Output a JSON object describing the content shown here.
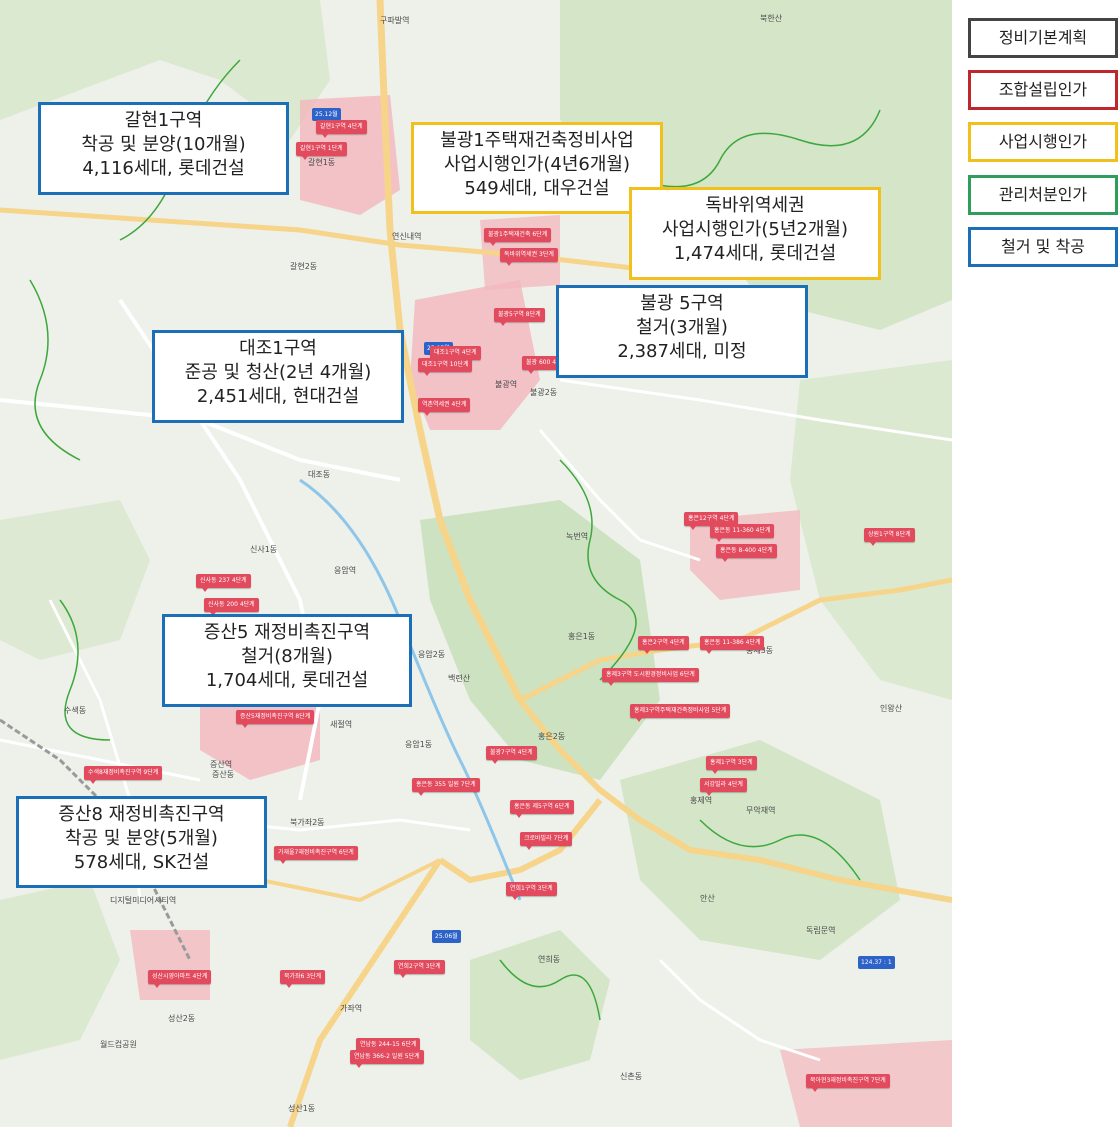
{
  "legend": [
    {
      "label": "정비기본계획",
      "color": "#444444"
    },
    {
      "label": "조합설립인가",
      "color": "#c0272d"
    },
    {
      "label": "사업시행인가",
      "color": "#f2c01c"
    },
    {
      "label": "관리처분인가",
      "color": "#2e9e5a"
    },
    {
      "label": "철거 및 착공",
      "color": "#1a6fb8"
    }
  ],
  "callouts": {
    "galhyeon1": {
      "lines": [
        "갈현1구역",
        "착공 및 분양(10개월)",
        "4,116세대, 롯데건설"
      ],
      "stage_color": "#1a6fb8"
    },
    "bulgwang1": {
      "lines": [
        "불광1주택재건축정비사업",
        "사업시행인가(4년6개월)",
        "549세대, 대우건설"
      ],
      "stage_color": "#f2c01c"
    },
    "dokbawi": {
      "lines": [
        "독바위역세권",
        "사업시행인가(5년2개월)",
        "1,474세대, 롯데건설"
      ],
      "stage_color": "#f2c01c"
    },
    "bulgwang5": {
      "lines": [
        "불광 5구역",
        "철거(3개월)",
        "2,387세대, 미정"
      ],
      "stage_color": "#1a6fb8"
    },
    "daejo1": {
      "lines": [
        "대조1구역",
        "준공 및 청산(2년 4개월)",
        "2,451세대, 현대건설"
      ],
      "stage_color": "#1a6fb8"
    },
    "jeungsan5": {
      "lines": [
        "증산5 재정비촉진구역",
        "철거(8개월)",
        "1,704세대, 롯데건설"
      ],
      "stage_color": "#1a6fb8"
    },
    "jeungsan8": {
      "lines": [
        "증산8 재정비촉진구역",
        "착공 및 분양(5개월)",
        "578세대, SK건설"
      ],
      "stage_color": "#1a6fb8"
    }
  },
  "map_labels": {
    "galhyeon1dong": "갈현1동",
    "galhyeon2dong": "갈현2동",
    "bulgwang2dong": "불광2동",
    "daejodong": "대조동",
    "sinsa1dong": "신사1동",
    "eungam2dong": "응암2동",
    "eungam1dong": "응암1동",
    "jeungsandong": "증산동",
    "susaekdong": "수색동",
    "hongeun1dong": "홍은1동",
    "hongeun2dong": "홍은2동",
    "yeonhuidong": "연희동",
    "sinchondong": "신촌동",
    "bukgajwa2dong": "북가좌2동",
    "seongsan2dong": "성산2동",
    "seongsan1dong": "성산1동",
    "hongje3dong": "홍제3동",
    "muakjae": "무악재역",
    "dokribmun": "독립문역",
    "bulgwang_stn": "불광역",
    "yeonsinnae_stn": "연신내역",
    "gupabal_stn": "구파발역",
    "eungam_stn": "응암역",
    "saejeol_stn": "새절역",
    "jeungsan_stn": "증산역",
    "gajwa_stn": "가좌역",
    "digital_stn": "디지털미디어시티역",
    "nokbeon_stn": "녹번역",
    "hongje_stn": "홍제역",
    "world_cup_park": "월드컵공원",
    "bukhansan": "북한산",
    "ansan": "안산",
    "baengnyeonsan": "백련산",
    "inwangsan": "인왕산"
  },
  "pins": [
    {
      "text": "갈현1구역  4단계"
    },
    {
      "text": "갈현1구역  1단계"
    },
    {
      "text": "대조1구역  4단계"
    },
    {
      "text": "대조1구역  10단계"
    },
    {
      "text": "불광1주택재건축  6단계"
    },
    {
      "text": "독바위역세권  3단계"
    },
    {
      "text": "불광5구역  8단계"
    },
    {
      "text": "불광 600  4단계"
    },
    {
      "text": "역촌역세권  4단계"
    },
    {
      "text": "홍은12구역  4단계"
    },
    {
      "text": "홍은동 11-360  4단계"
    },
    {
      "text": "홍은동 8-400  4단계"
    },
    {
      "text": "신사동 237  4단계"
    },
    {
      "text": "신사동 200  4단계"
    },
    {
      "text": "증산5재정비촉진구역  8단계"
    },
    {
      "text": "수색8재정비촉진구역  9단계"
    },
    {
      "text": "가재울7재정비촉진구역  6단계"
    },
    {
      "text": "홍은2구역  4단계"
    },
    {
      "text": "홍제3구역 도시환경정비사업  6단계"
    },
    {
      "text": "홍제3구역주택재건축정비사업  5단계"
    },
    {
      "text": "홍제1구역  3단계"
    },
    {
      "text": "서강빌라  4단계"
    },
    {
      "text": "홍은동 355 일원  7단계"
    },
    {
      "text": "홍은동 제5구역  6단계"
    },
    {
      "text": "크로바빌라  7단계"
    },
    {
      "text": "연희1구역  3단계"
    },
    {
      "text": "연희2구역  3단계"
    },
    {
      "text": "성산시영아파트  4단계"
    },
    {
      "text": "북가좌6  3단계"
    },
    {
      "text": "연남동 244-15  6단계"
    },
    {
      "text": "연남동 366-2 일원  5단계"
    },
    {
      "text": "북아현3재정비촉진구역  7단계"
    },
    {
      "text": "상원1구역  8단계"
    },
    {
      "text": "홍은동 11-386  4단계"
    },
    {
      "text": "불광7구역  4단계"
    }
  ],
  "station_badges": [
    {
      "text": "25.12월"
    },
    {
      "text": "25.05월"
    },
    {
      "text": "25.06월"
    },
    {
      "text": "124.37 : 1"
    }
  ]
}
